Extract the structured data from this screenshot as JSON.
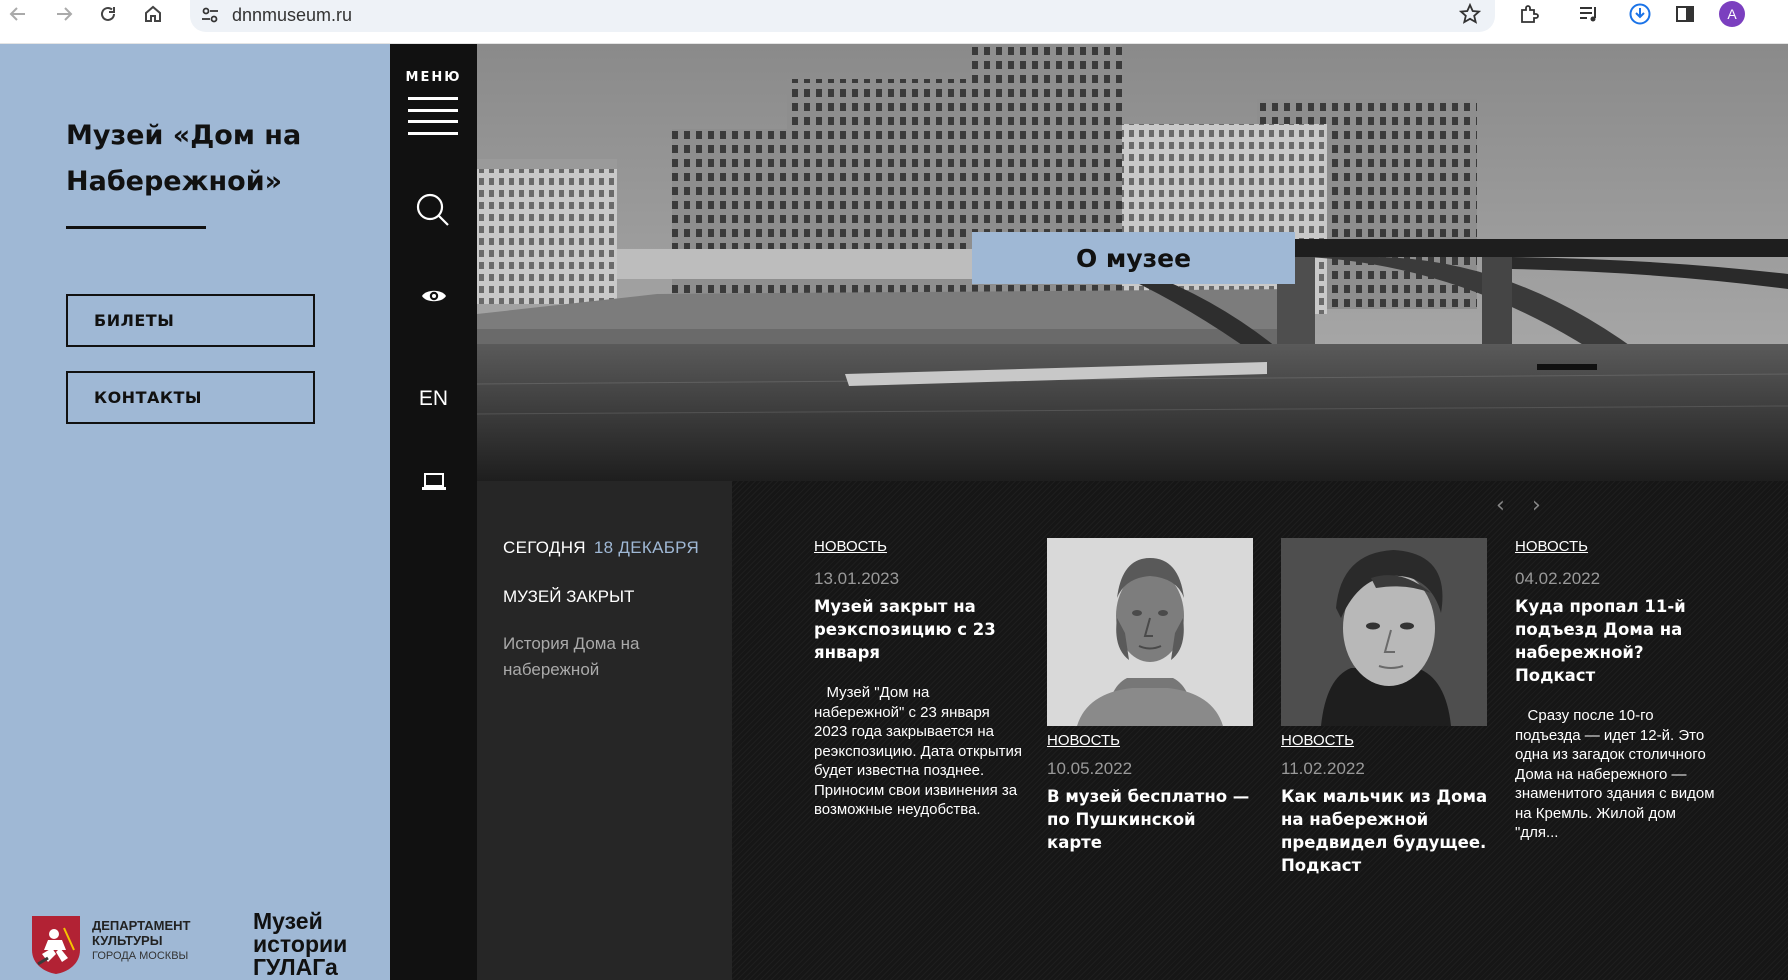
{
  "browser": {
    "url": "dnnmuseum.ru",
    "profile_initial": "A",
    "icons": [
      "back-icon",
      "forward-icon",
      "reload-icon",
      "home-icon",
      "site-settings-icon",
      "bookmark-star-icon",
      "extensions-icon",
      "media-controls-icon",
      "downloads-icon",
      "side-panel-icon"
    ]
  },
  "sidebar": {
    "title": "Музей «Дом на Набережной»",
    "buttons": [
      {
        "label": "БИЛЕТЫ"
      },
      {
        "label": "КОНТАКТЫ"
      }
    ],
    "logos": {
      "dept_line1": "ДЕПАРТАМЕНТ",
      "dept_line2": "КУЛЬТУРЫ",
      "dept_line3": "ГОРОДА МОСКВЫ",
      "gulag_line1": "Музей",
      "gulag_line2": "истории",
      "gulag_line3": "ГУЛАГа"
    }
  },
  "toolbar": {
    "menu_label": "МЕНЮ",
    "icons": [
      "hamburger-icon",
      "search-icon",
      "eye-icon",
      "laptop-icon"
    ],
    "lang": "EN"
  },
  "hero": {
    "label": "О музее"
  },
  "today": {
    "label": "СЕГОДНЯ",
    "date": "18 ДЕКАБРЯ",
    "status": "МУЗЕЙ ЗАКРЫТ",
    "link": "История Дома на набережной"
  },
  "news": {
    "prev": "‹",
    "next": "›",
    "items": [
      {
        "category": "НОВОСТЬ",
        "date": "13.01.2023",
        "headline": "Музей закрыт на реэкспозицию с 23 января",
        "excerpt": "   Музей \"Дом на набережной\" с 23 января 2023 года закрывается на реэкспозицию. Дата открытия будет известна позднее.  Приносим свои извинения за возможные неудобства."
      },
      {
        "category": "НОВОСТЬ",
        "date": "10.05.2022",
        "headline": "В музей бесплатно — по Пушкинской карте",
        "photo": "pushkin-bust-photo"
      },
      {
        "category": "НОВОСТЬ",
        "date": "11.02.2022",
        "headline": "Как мальчик из Дома на набережной предвидел будущее. Подкаст",
        "photo": "boy-portrait-photo"
      },
      {
        "category": "НОВОСТЬ",
        "date": "04.02.2022",
        "headline": "Куда пропал 11-й подъезд Дома на набережной? Подкаст",
        "excerpt": "   Сразу после 10-го подъезда — идет 12-й. Это одна из загадок столичного Дома на набережного — знаменитого здания с видом на Кремль. Жилой дом \"для..."
      }
    ]
  }
}
